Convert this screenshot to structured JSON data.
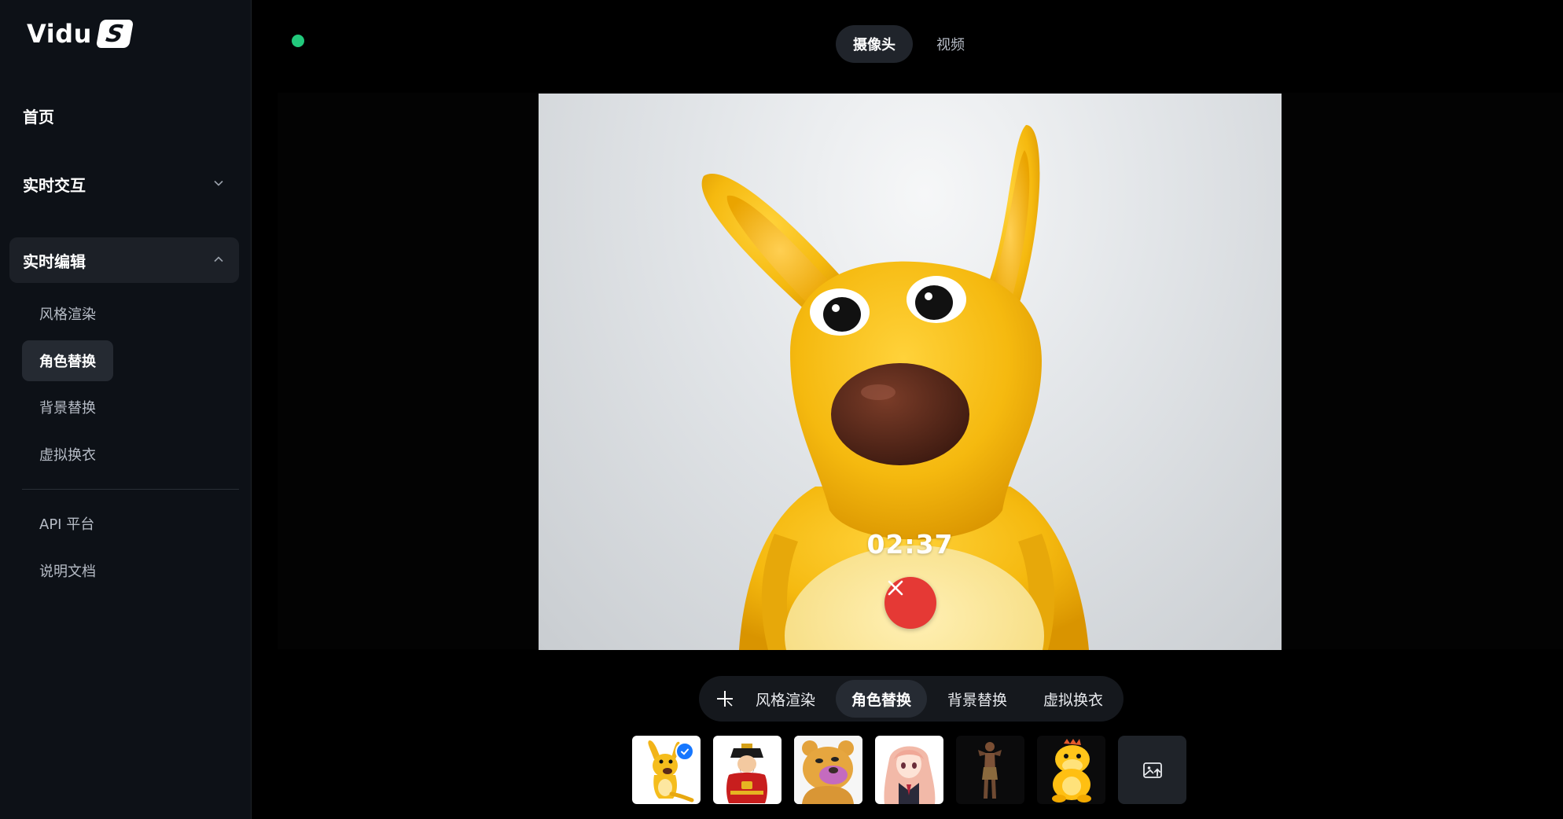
{
  "logo": {
    "text": "Vidu",
    "badge": "S"
  },
  "sidebar": {
    "home": "首页",
    "realtime_interact": "实时交互",
    "realtime_edit": "实时编辑",
    "sub_items": [
      "风格渲染",
      "角色替换",
      "背景替换",
      "虚拟换衣"
    ],
    "active_sub_index": 1,
    "api": "API 平台",
    "docs": "说明文档"
  },
  "status": {
    "color": "#22c97c"
  },
  "source_tabs": {
    "camera": "摄像头",
    "video": "视频",
    "active": "camera"
  },
  "stage": {
    "timer": "02:37",
    "end_call_icon": "close-icon"
  },
  "modes": {
    "items": [
      "风格渲染",
      "角色替换",
      "背景替换",
      "虚拟换衣"
    ],
    "active_index": 1,
    "add_icon": "plus-icon"
  },
  "characters": {
    "items": [
      "kangaroo",
      "god-of-wealth",
      "bear",
      "anime-girl",
      "caveman",
      "yellow-dragon"
    ],
    "selected_index": 0,
    "upload_icon": "image-upload-icon"
  },
  "colors": {
    "accent_check": "#1677ff",
    "end_call": "#e53935",
    "sidebar_bg": "#0d1117"
  }
}
